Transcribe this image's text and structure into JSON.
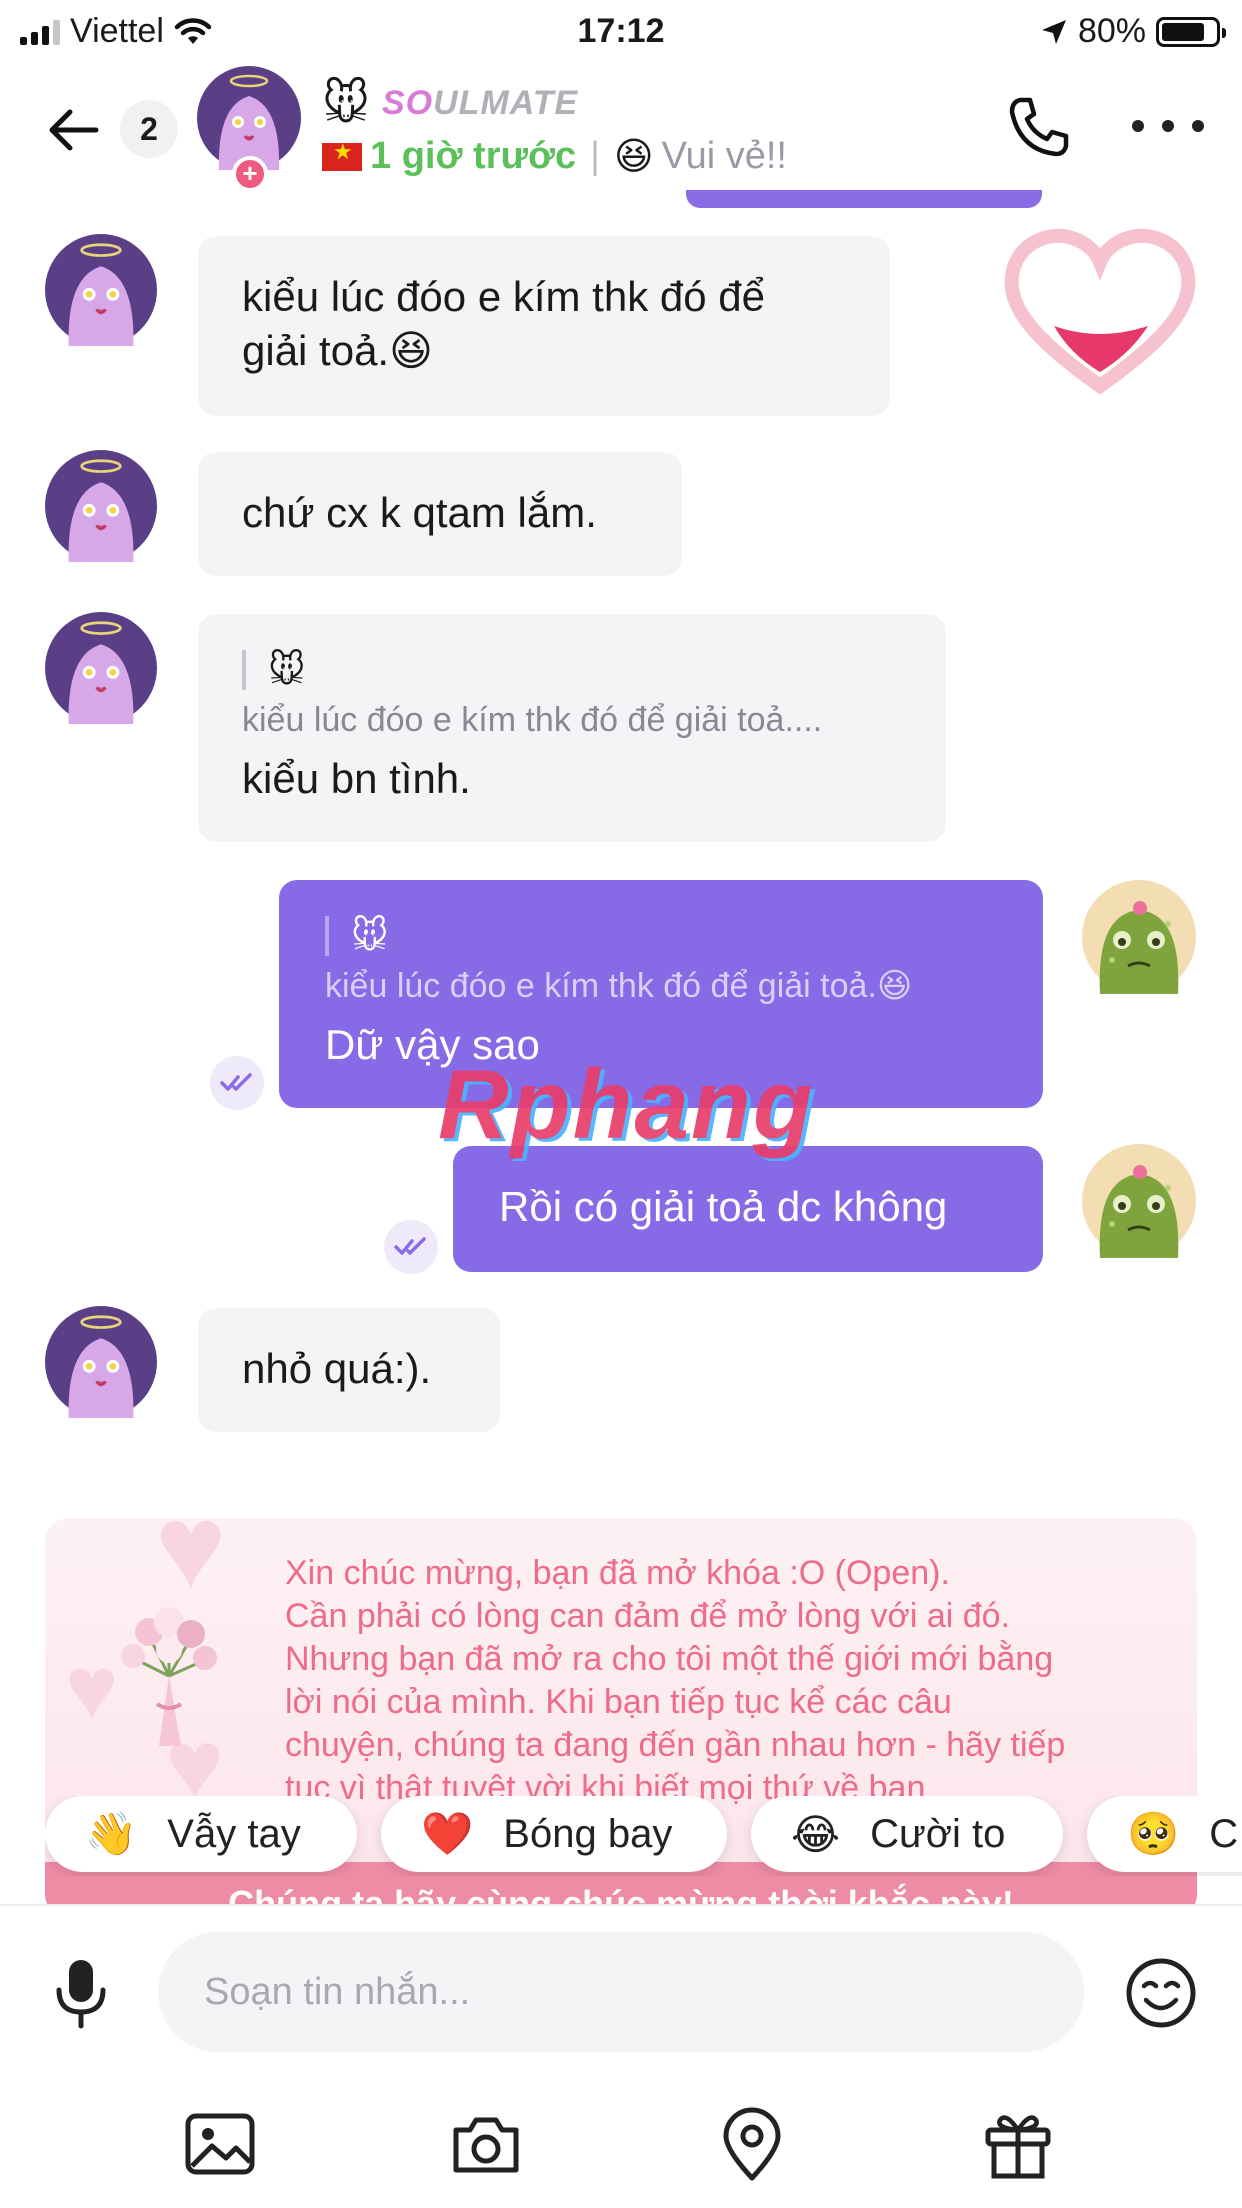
{
  "status_bar": {
    "carrier": "Viettel",
    "time": "17:12",
    "battery": "80%"
  },
  "header": {
    "unread_count": "2",
    "name_emoji": "🐭",
    "badge_text_highlight": "SO",
    "badge_text": "ULMATE",
    "last_seen": "1 giờ trước",
    "mood_emoji": "😆",
    "mood": "Vui vẻ!!"
  },
  "messages": [
    {
      "side": "in",
      "line1": "kiểu lúc đóo e kím thk đó để",
      "line2": "giải toả.",
      "emoji": "😆"
    },
    {
      "side": "in",
      "text": "chứ cx k qtam lắm."
    },
    {
      "side": "in",
      "quote_name": "🐭",
      "quote_text": "kiểu lúc đóo e kím thk đó để giải toả....",
      "text": "kiểu bn tình."
    },
    {
      "side": "out",
      "quote_name": "🐭",
      "quote_text": "kiểu lúc đóo e kím thk đó để giải toả.😆",
      "text": "Dữ vậy sao"
    },
    {
      "side": "out",
      "text": "Rồi có giải toả dc không"
    },
    {
      "side": "in",
      "text": "nhỏ quá:)."
    }
  ],
  "watermark": "Rphang",
  "congrats": {
    "lines": [
      "Xin chúc mừng, bạn đã mở khóa :O (Open).",
      "Cần phải có lòng can đảm để mở lòng với ai đó.",
      "Nhưng bạn đã mở ra cho tôi một thế giới mới bằng",
      "lời nói của mình. Khi bạn tiếp tục kể các câu",
      "chuyện, chúng ta đang đến gần nhau hơn - hãy tiếp",
      "tục vì thật tuyệt vời khi biết mọi thứ về bạn"
    ],
    "footer": "Chúng ta hãy cùng chúc mừng thời khắc này!"
  },
  "quick_reactions": [
    {
      "emoji": "👋",
      "label": "Vẫy tay"
    },
    {
      "emoji": "❤️",
      "label": "Bóng bay"
    },
    {
      "emoji": "😂",
      "label": "Cười to"
    },
    {
      "emoji": "🥺",
      "label": "C"
    }
  ],
  "composer": {
    "placeholder": "Soạn tin nhắn..."
  },
  "colors": {
    "accent": "#876ae6",
    "incoming_bubble": "#f4f4f6",
    "online": "#5cc05a",
    "congrats_text": "#ee6b8a"
  }
}
